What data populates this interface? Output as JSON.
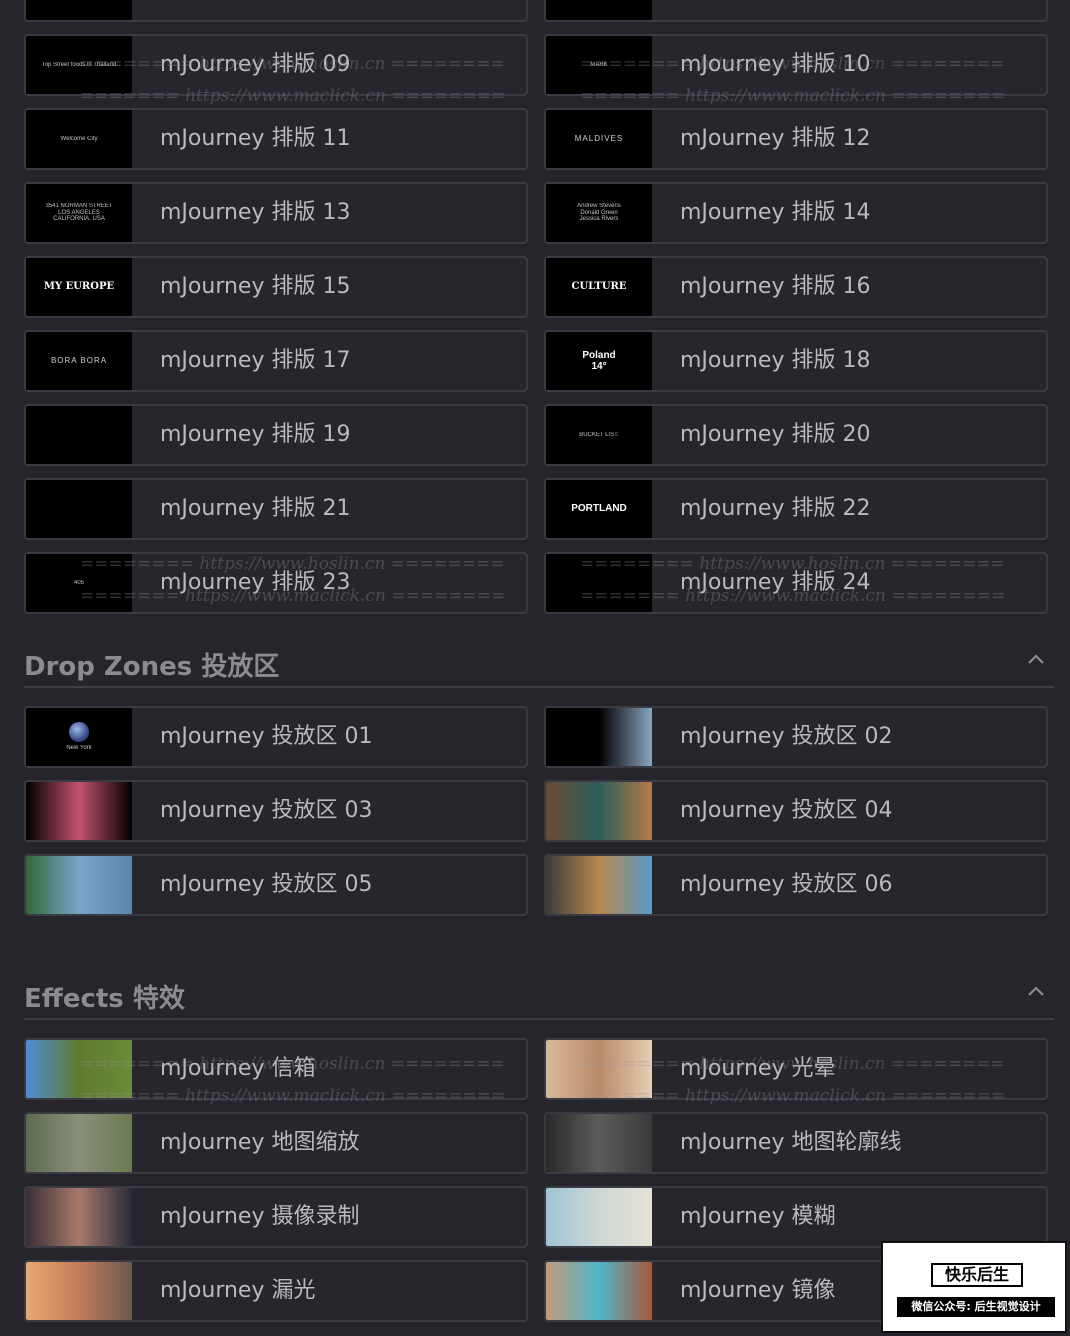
{
  "layouts_grid": {
    "items": [
      {
        "label": "mJourney 排版 09",
        "thumb": {
          "text": "Top Street foods in Thailand",
          "style": "tiny"
        }
      },
      {
        "label": "mJourney 排版 10",
        "thumb": {
          "text": "MARK",
          "style": "tiny"
        }
      },
      {
        "label": "mJourney 排版 11",
        "thumb": {
          "text": "Welcome City",
          "style": "tiny"
        }
      },
      {
        "label": "mJourney 排版 12",
        "thumb": {
          "text": "MALDIVES",
          "style": "caps"
        }
      },
      {
        "label": "mJourney 排版 13",
        "thumb": {
          "text": "3541 NORMAN STREET\nLOS ANGELES\nCALIFORNIA, USA",
          "style": "tiny"
        }
      },
      {
        "label": "mJourney 排版 14",
        "thumb": {
          "text": "Andrew Stevens\nDonald Green\nJessica Rivers",
          "style": "tiny"
        }
      },
      {
        "label": "mJourney 排版 15",
        "thumb": {
          "text": "MY EUROPE",
          "style": "serif"
        }
      },
      {
        "label": "mJourney 排版 16",
        "thumb": {
          "text": "CULTURE",
          "style": "serif"
        }
      },
      {
        "label": "mJourney 排版 17",
        "thumb": {
          "text": "BORA BORA",
          "style": "caps"
        }
      },
      {
        "label": "mJourney 排版 18",
        "thumb": {
          "text": "Poland\n14°",
          "style": "bold"
        }
      },
      {
        "label": "mJourney 排版 19",
        "thumb": {
          "text": "",
          "style": "tiny"
        }
      },
      {
        "label": "mJourney 排版 20",
        "thumb": {
          "text": "BUCKET LIST:",
          "style": "tiny"
        }
      },
      {
        "label": "mJourney 排版 21",
        "thumb": {
          "text": "",
          "style": "tiny"
        }
      },
      {
        "label": "mJourney 排版 22",
        "thumb": {
          "text": "PORTLAND",
          "style": "bold"
        }
      },
      {
        "label": "mJourney 排版 23",
        "thumb": {
          "text": "405",
          "style": "tiny"
        }
      },
      {
        "label": "mJourney 排版 24",
        "thumb": {
          "text": "",
          "style": "tiny"
        }
      }
    ]
  },
  "drop_zones": {
    "title": "Drop Zones 投放区",
    "items": [
      {
        "label": "mJourney 投放区 01",
        "thumb": {
          "kind": "orb",
          "text": "New York"
        }
      },
      {
        "label": "mJourney 投放区 02",
        "thumb": {
          "kind": "photo",
          "colors": [
            "#000000",
            "#000000",
            "#8aa6c2"
          ]
        }
      },
      {
        "label": "mJourney 投放区 03",
        "thumb": {
          "kind": "photo",
          "colors": [
            "#000000",
            "#c4526e",
            "#000000"
          ]
        }
      },
      {
        "label": "mJourney 投放区 04",
        "thumb": {
          "kind": "photo",
          "colors": [
            "#6b4a35",
            "#2d5e5c",
            "#b57a45"
          ]
        }
      },
      {
        "label": "mJourney 投放区 05",
        "thumb": {
          "kind": "photo",
          "colors": [
            "#2f6a3a",
            "#7aa4c9",
            "#5b86ad"
          ]
        }
      },
      {
        "label": "mJourney 投放区 06",
        "thumb": {
          "kind": "photo",
          "colors": [
            "#3b3b3b",
            "#b8874f",
            "#5a9ac9"
          ]
        }
      }
    ]
  },
  "effects": {
    "title": "Effects 特效",
    "items": [
      {
        "label": "mJourney 信箱",
        "thumb": {
          "kind": "photo",
          "colors": [
            "#4f8dd6",
            "#5f7a2e",
            "#6c8b3a"
          ]
        }
      },
      {
        "label": "mJourney 光晕",
        "thumb": {
          "kind": "photo",
          "colors": [
            "#d8b89a",
            "#b98a6a",
            "#e6cdb3"
          ]
        }
      },
      {
        "label": "mJourney 地图缩放",
        "thumb": {
          "kind": "photo",
          "colors": [
            "#5d6b50",
            "#8a8f7a",
            "#6a7a52"
          ]
        }
      },
      {
        "label": "mJourney 地图轮廓线",
        "thumb": {
          "kind": "photo",
          "colors": [
            "#2a2a2a",
            "#5c5c5c",
            "#3a3a3a"
          ]
        }
      },
      {
        "label": "mJourney 摄像录制",
        "thumb": {
          "kind": "photo",
          "colors": [
            "#3a2d35",
            "#a77a6a",
            "#2a2a3a"
          ]
        }
      },
      {
        "label": "mJourney 模糊",
        "thumb": {
          "kind": "photo",
          "colors": [
            "#9fc4d6",
            "#cfd8d5",
            "#e6e2d6"
          ]
        }
      },
      {
        "label": "mJourney 漏光",
        "thumb": {
          "kind": "photo",
          "colors": [
            "#e8a870",
            "#c57b5a",
            "#6a5a50"
          ]
        }
      },
      {
        "label": "mJourney 镜像",
        "thumb": {
          "kind": "photo",
          "colors": [
            "#c49a7a",
            "#4fb7c9",
            "#a5573c"
          ]
        }
      }
    ]
  },
  "watermarks": [
    "======== https://www.hoslin.cn ========",
    "======= https://www.maclick.cn ========"
  ],
  "badge": {
    "title": "快乐后生",
    "subtitle": "微信公众号: 后生视觉设计"
  },
  "colors": {
    "background": "#25252b",
    "card_border": "#3a3a42",
    "label_text": "#b9b9bf",
    "section_title": "#8b8b92"
  },
  "icons": {
    "collapse": "chevron-up-icon"
  }
}
